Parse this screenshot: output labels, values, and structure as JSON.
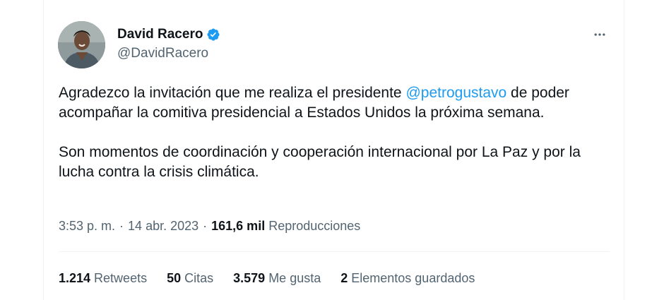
{
  "author": {
    "name": "David Racero",
    "handle": "@DavidRacero",
    "avatar_icon": "profile-photo",
    "verified_icon": "verified-badge-icon"
  },
  "tweet": {
    "paragraph1_before": "Agradezco la invitación que me realiza el presidente ",
    "mention": "@petrogustavo",
    "paragraph1_after": " de poder acompañar la comitiva presidencial a Estados Unidos la próxima semana.",
    "paragraph2": "Son momentos de coordinación y cooperación internacional por La Paz y por la lucha contra la crisis climática."
  },
  "meta": {
    "time": "3:53 p. m.",
    "separator": "·",
    "date": "14 abr. 2023",
    "views_count": "161,6 mil",
    "views_label": "Reproducciones"
  },
  "stats": [
    {
      "count": "1.214",
      "label": "Retweets"
    },
    {
      "count": "50",
      "label": "Citas"
    },
    {
      "count": "3.579",
      "label": "Me gusta"
    },
    {
      "count": "2",
      "label": "Elementos guardados"
    }
  ],
  "colors": {
    "accent": "#1d9bf0",
    "text_primary": "#0f1419",
    "text_secondary": "#536471",
    "divider": "#eff3f4"
  },
  "more_icon": "more-options-icon"
}
